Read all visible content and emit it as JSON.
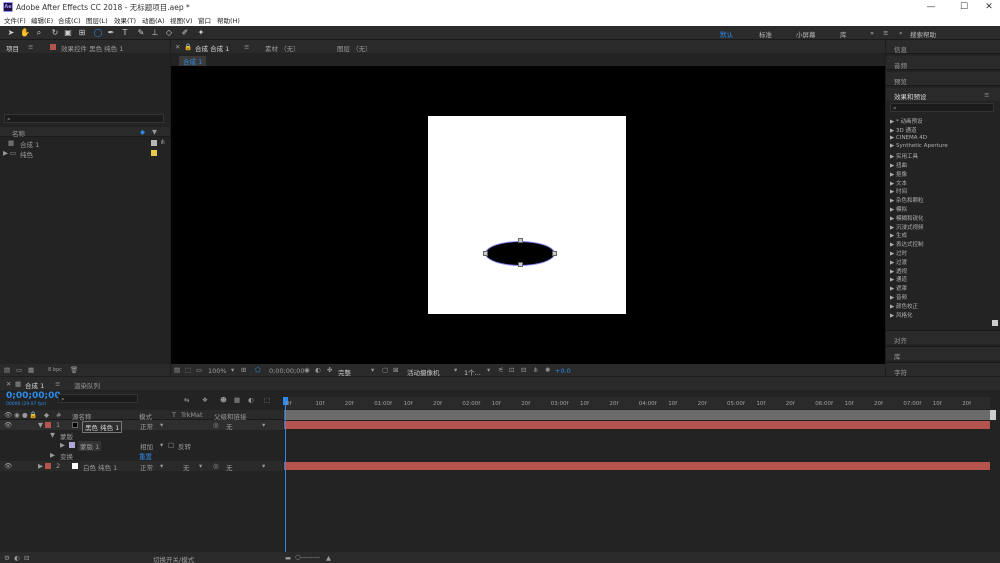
{
  "app": {
    "title": "Adobe After Effects CC 2018 - 无标题项目.aep *",
    "icon_label": "Ae",
    "window_buttons": [
      "—",
      "☐",
      "✕"
    ]
  },
  "menu": [
    "文件(F)",
    "编辑(E)",
    "合成(C)",
    "图层(L)",
    "效果(T)",
    "动画(A)",
    "视图(V)",
    "窗口",
    "帮助(H)"
  ],
  "workspaces": {
    "items": [
      "默认",
      "标准",
      "小屏幕",
      "库"
    ],
    "active": "默认",
    "search_placeholder": "搜索帮助"
  },
  "project_panel": {
    "tab_label": "项目",
    "effect_controls_label": "效果控件 黑色 纯色 1",
    "search_placeholder": "",
    "column_name": "名称",
    "items": [
      {
        "name": "合成 1",
        "color": "#b5b5b5"
      },
      {
        "name": "纯色",
        "color": "#e6c84a"
      }
    ],
    "bpc": "8 bpc"
  },
  "composition_panel": {
    "tabs": [
      "合成 合成 1",
      "素材 （无）",
      "图层 （无）"
    ],
    "breadcrumb": "合成 1",
    "zoom": "100%",
    "timecode": "0;00;00;00",
    "resolution": "完整",
    "camera": "活动摄像机",
    "views": "1个...",
    "exposure": "+0.0",
    "colors": {
      "bg": "#000000",
      "solid": "#ffffff",
      "ellipse": "#000000"
    }
  },
  "right_panels": {
    "tabs_top": [
      "信息",
      "音频",
      "预览"
    ],
    "effects_title": "效果和预设",
    "search_placeholder": "",
    "effects": [
      "* 动画预设",
      "3D 通道",
      "CINEMA 4D",
      "Synthetic Aperture",
      "实用工具",
      "扭曲",
      "抠像",
      "文本",
      "时间",
      "杂色和颗粒",
      "模拟",
      "模糊和锐化",
      "沉浸式视频",
      "生成",
      "表达式控制",
      "过时",
      "过渡",
      "透视",
      "通道",
      "遮罩",
      "音频",
      "颜色校正",
      "风格化"
    ],
    "tabs_bottom": [
      "对齐",
      "库",
      "字符"
    ]
  },
  "timeline": {
    "tab_label": "合成 1",
    "render_queue_label": "渲染队列",
    "timecode": "0;00;00;00",
    "fps": "00000 (29.97 fps)",
    "columns": {
      "num": "#",
      "source_name": "源名称",
      "mode": "模式",
      "t": "T",
      "trkmat": "TrkMat",
      "parent": "父级和链接"
    },
    "layers": [
      {
        "num": "1",
        "name": "黑色 纯色 1",
        "mode": "正常",
        "parent": "无",
        "color": "#b5534e"
      },
      {
        "num": "2",
        "name": "白色 纯色 1",
        "mode": "正常",
        "trkmat": "无",
        "parent": "无",
        "color": "#b5534e"
      }
    ],
    "mask_group": "蒙版",
    "mask": {
      "name": "蒙版 1",
      "mode": "相加",
      "invert": "反转"
    },
    "transform": "变换",
    "reset": "重置",
    "ruler": [
      "0f",
      "10f",
      "20f",
      "01:00f",
      "10f",
      "20f",
      "02:00f",
      "10f",
      "20f",
      "03:00f",
      "10f",
      "20f",
      "04:00f",
      "10f",
      "20f",
      "05:00f",
      "10f",
      "20f",
      "06:00f",
      "10f",
      "20f",
      "07:00f",
      "10f",
      "20f"
    ],
    "footer_toggle": "切换开关/模式"
  }
}
